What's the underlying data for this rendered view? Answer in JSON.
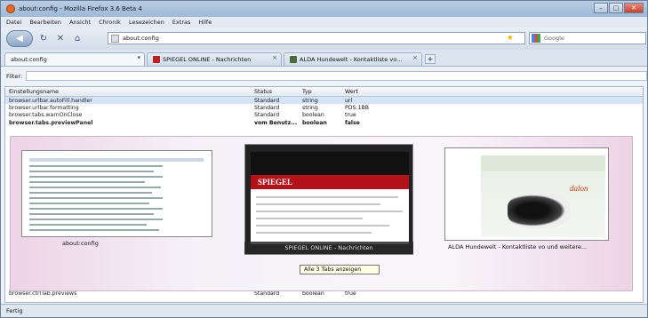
{
  "window": {
    "title": "about:config - Mozilla Firefox 3.6 Beta 4",
    "buttons": [
      "–",
      "□",
      "✕"
    ]
  },
  "menu": [
    "Datei",
    "Bearbeiten",
    "Ansicht",
    "Chronik",
    "Lesezeichen",
    "Extras",
    "Hilfe"
  ],
  "nav": {
    "url": "about:config",
    "search_placeholder": "Google"
  },
  "tabs": [
    {
      "label": "about:config"
    },
    {
      "label": "SPIEGEL ONLINE - Nachrichten"
    },
    {
      "label": "ALDA Hundewelt - Kontaktliste vo..."
    }
  ],
  "filter": {
    "label": "Filter:"
  },
  "table": {
    "headers": [
      "Einstellungsname",
      "Status",
      "Typ",
      "Wert"
    ],
    "rows": [
      {
        "name": "browser.urlbar.autoFill.handler",
        "status": "Standard",
        "type": "string",
        "value": "url",
        "sel": true
      },
      {
        "name": "browser.urlbar.formatting",
        "status": "Standard",
        "type": "string",
        "value": "PDS:1BB",
        "sel": false
      },
      {
        "name": "browser.tabs.warnOnClose",
        "status": "Standard",
        "type": "boolean",
        "value": "true",
        "sel": false
      },
      {
        "name": "browser.tabs.previewPanel",
        "status": "vom Benutz...",
        "type": "boolean",
        "value": "false",
        "sel": false
      }
    ],
    "bottom_row": {
      "name": "browser.ctrlTab.previews",
      "status": "Standard",
      "type": "boolean",
      "value": "true"
    }
  },
  "previews": {
    "left_caption": "about:config",
    "center_caption": "SPIEGEL ONLINE - Nachrichten",
    "right_caption": "ALDA Hundewelt - Kontaktliste vo und weitere..."
  },
  "tooltip": "Alle 3 Tabs anzeigen",
  "status": "Fertig",
  "colors": {
    "accent": "#b3121b",
    "selection": "#d6e4f7"
  }
}
